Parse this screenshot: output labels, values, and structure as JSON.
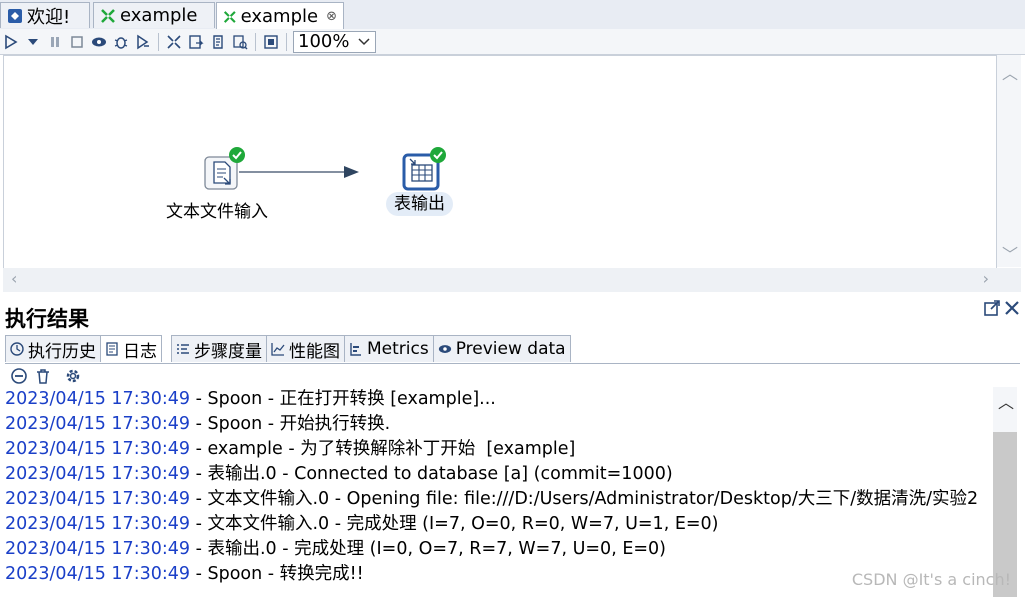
{
  "tabs": [
    {
      "label": "欢迎!",
      "icon": "welcome-icon"
    },
    {
      "label": "example",
      "icon": "transformation-icon"
    },
    {
      "label": "example",
      "icon": "transformation-icon",
      "close": "⊗"
    }
  ],
  "toolbar": {
    "zoom": "100%"
  },
  "canvas": {
    "steps": [
      {
        "label": "文本文件输入",
        "icon": "text-file-input-icon"
      },
      {
        "label": "表输出",
        "icon": "table-output-icon"
      }
    ]
  },
  "results": {
    "title": "执行结果",
    "tabs": [
      {
        "label": "执行历史",
        "icon": "history-icon"
      },
      {
        "label": "日志",
        "icon": "log-icon"
      },
      {
        "label": "步骤度量",
        "icon": "step-metrics-icon"
      },
      {
        "label": "性能图",
        "icon": "performance-chart-icon"
      },
      {
        "label": "Metrics",
        "icon": "metrics-icon"
      },
      {
        "label": "Preview data",
        "icon": "preview-eye-icon"
      }
    ]
  },
  "log": [
    {
      "ts": "2023/04/15 17:30:49",
      "msg": " - Spoon - 正在打开转换 [example]..."
    },
    {
      "ts": "2023/04/15 17:30:49",
      "msg": " - Spoon - 开始执行转换."
    },
    {
      "ts": "2023/04/15 17:30:49",
      "msg": " - example - 为了转换解除补丁开始  [example]"
    },
    {
      "ts": "2023/04/15 17:30:49",
      "msg": " - 表输出.0 - Connected to database [a] (commit=1000)"
    },
    {
      "ts": "2023/04/15 17:30:49",
      "msg": " - 文本文件输入.0 - Opening file: file:///D:/Users/Administrator/Desktop/大三下/数据清洗/实验2"
    },
    {
      "ts": "2023/04/15 17:30:49",
      "msg": " - 文本文件输入.0 - 完成处理 (I=7, O=0, R=0, W=7, U=1, E=0)"
    },
    {
      "ts": "2023/04/15 17:30:49",
      "msg": " - 表输出.0 - 完成处理 (I=0, O=7, R=7, W=7, U=0, E=0)"
    },
    {
      "ts": "2023/04/15 17:30:49",
      "msg": " - Spoon - 转换完成!!"
    }
  ],
  "watermark": "CSDN @It's a cinch!",
  "colors": {
    "accent": "#1a3fc8",
    "success": "#1fa83a",
    "step_border": "#2a5ca8"
  }
}
